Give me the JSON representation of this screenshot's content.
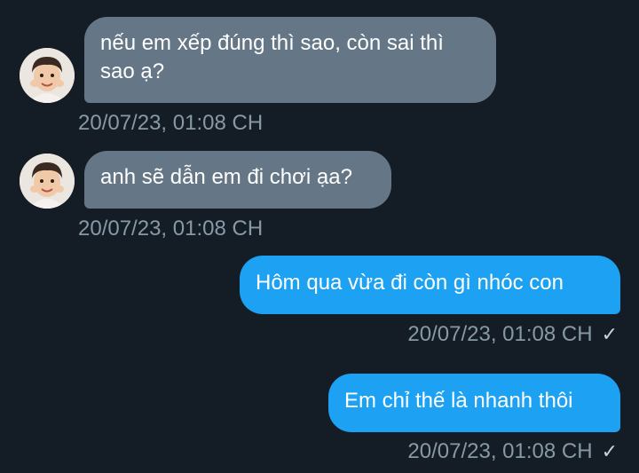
{
  "messages": [
    {
      "direction": "incoming",
      "text": "nếu em xếp đúng thì sao, còn sai thì sao ạ?",
      "timestamp": "20/07/23, 01:08 CH"
    },
    {
      "direction": "incoming",
      "text": "anh sẽ dẫn em đi chơi ạa?",
      "timestamp": "20/07/23, 01:08 CH"
    },
    {
      "direction": "outgoing",
      "text": "Hôm qua vừa đi còn gì nhóc con",
      "timestamp": "20/07/23, 01:08 CH",
      "status_icon": "single-check-icon"
    },
    {
      "direction": "outgoing",
      "text": "Em chỉ thế là nhanh thôi",
      "timestamp": "20/07/23, 01:08 CH",
      "status_icon": "single-check-icon"
    }
  ],
  "colors": {
    "background": "#141d26",
    "incoming_bubble": "#657786",
    "outgoing_bubble": "#1da1f2",
    "timestamp": "#8899a6"
  }
}
